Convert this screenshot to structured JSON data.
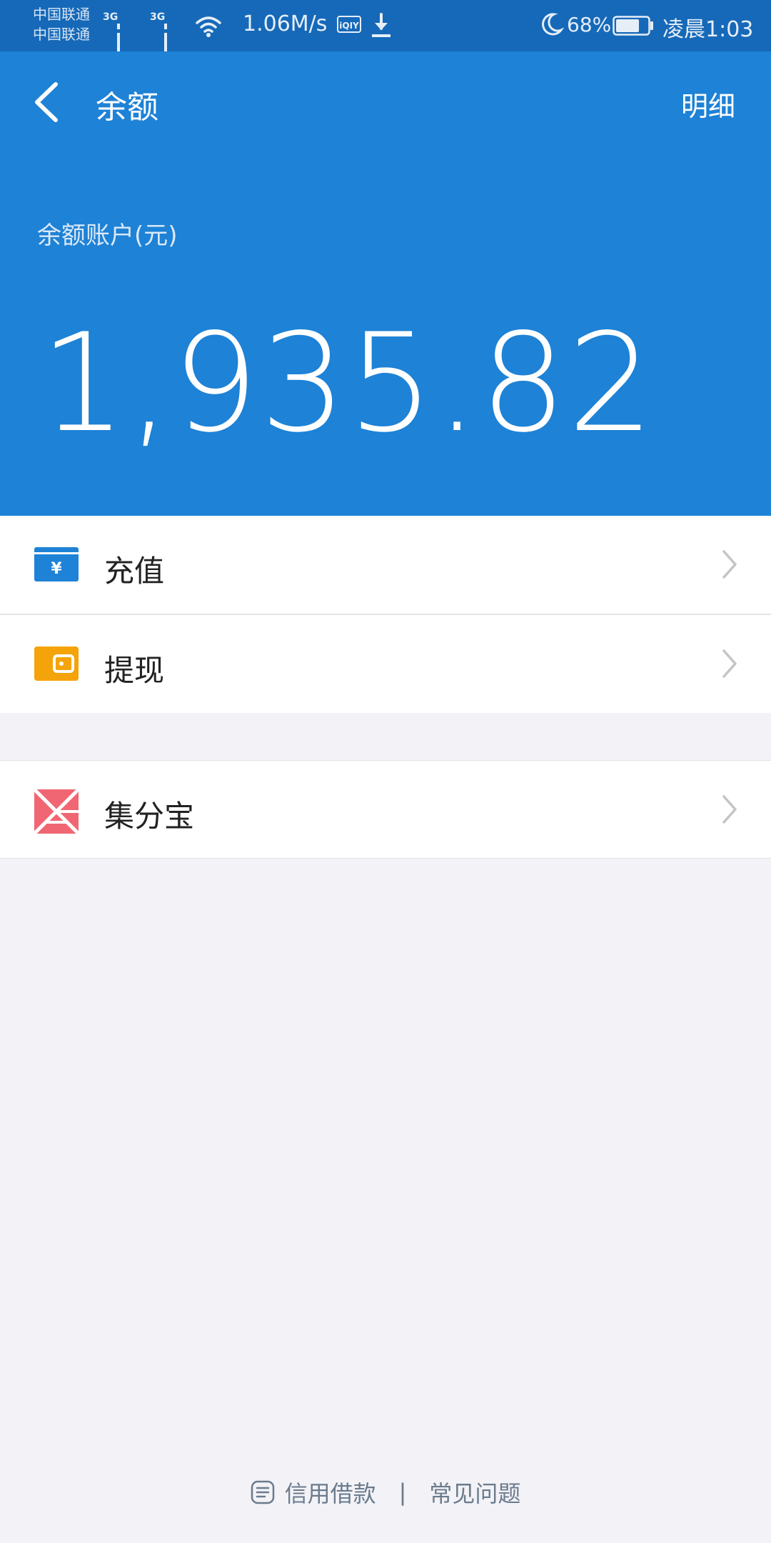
{
  "status_bar": {
    "carrier_1": "中国联通",
    "carrier_2": "中国联通",
    "network_1": "3G",
    "network_2": "3G",
    "speed": "1.06M/s",
    "app_badge": "iQIY",
    "battery": "68%",
    "time": "凌晨1:03",
    "icons": [
      "signal-icon",
      "wifi-icon",
      "iqiyi-icon",
      "download-icon",
      "moon-icon",
      "battery-icon"
    ]
  },
  "header": {
    "title": "余额",
    "detail_link": "明细",
    "balance_label": "余额账户(元)",
    "balance_amount": "1,935.82"
  },
  "menu": {
    "items": [
      {
        "label": "充值",
        "icon": "recharge-icon",
        "color": "#1e82d6"
      },
      {
        "label": "提现",
        "icon": "wallet-icon",
        "color": "#f5a30a"
      },
      {
        "label": "集分宝",
        "icon": "jifenbao-icon",
        "color": "#f06672"
      }
    ]
  },
  "footer": {
    "credit_link": "信用借款",
    "separator": "|",
    "faq_link": "常见问题"
  },
  "colors": {
    "status_bar": "#1669b8",
    "header": "#1e82d6",
    "background": "#f2f2f7"
  }
}
